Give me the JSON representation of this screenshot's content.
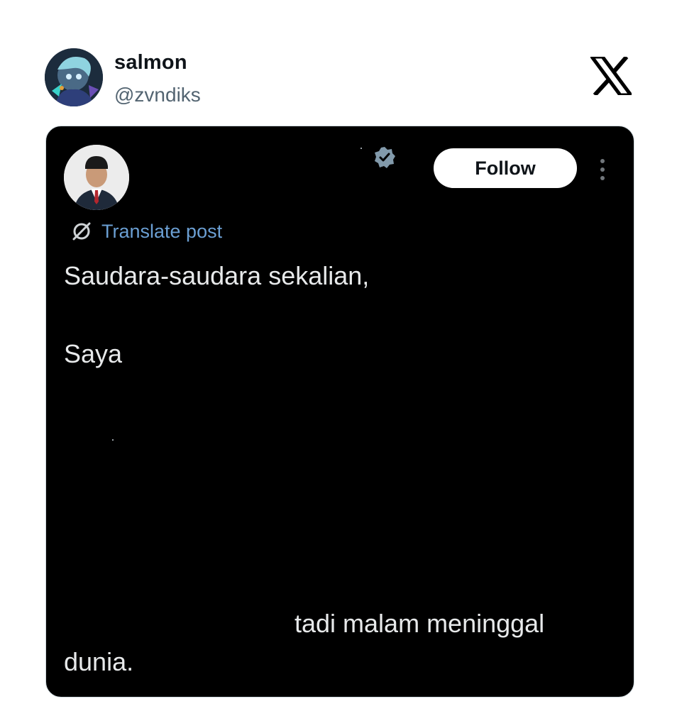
{
  "embed": {
    "author": {
      "name": "salmon",
      "handle": "@zvndiks"
    },
    "brand_logo": "x-logo-icon"
  },
  "post": {
    "follow_label": "Follow",
    "translate_label": "Translate post",
    "verified_icon": "verified-badge-icon",
    "more_icon": "more-vertical-icon",
    "globe_icon": "globe-icon",
    "lines": [
      "Saudara-saudara sekalian,",
      "Saya",
      "tadi malam meninggal",
      "dunia."
    ]
  },
  "colors": {
    "card_background": "#000000",
    "post_text": "#e7e9ea",
    "translate_link": "#6b9fd3",
    "verified_badge": "#829aab",
    "handle_text": "#536471"
  }
}
